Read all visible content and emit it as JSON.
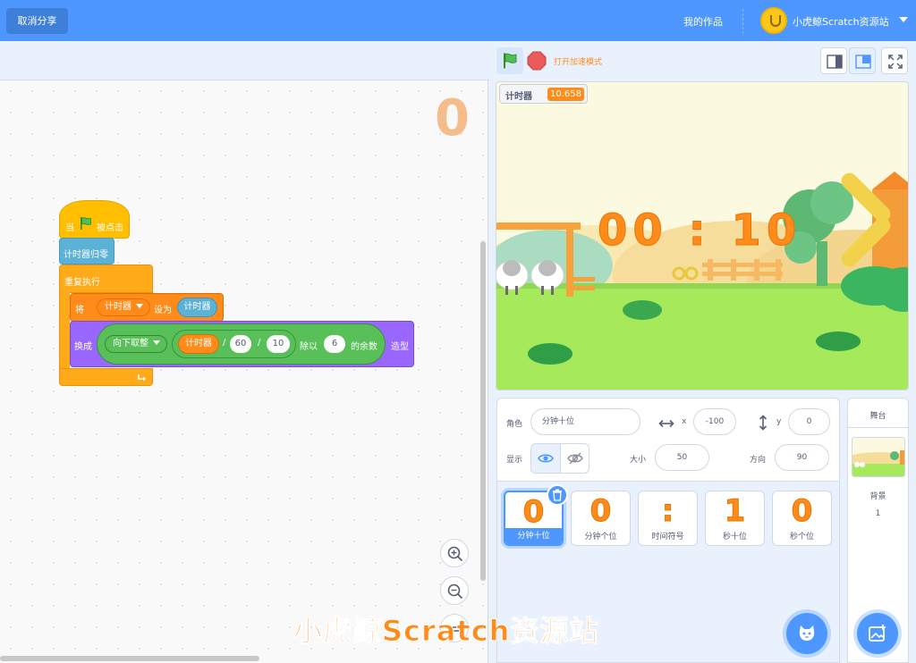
{
  "topbar": {
    "cancel_share": "取消分享",
    "my_works": "我的作品",
    "username": "小虎鲸Scratch资源站"
  },
  "code": {
    "watermark_costume": "0",
    "hat_when": "当",
    "hat_clicked": "被点击",
    "reset_timer": "计时器归零",
    "forever": "重复执行",
    "set_label": "将",
    "set_var": "计时器",
    "set_to": "设为",
    "set_value_reporter": "计时器",
    "switch_label": "换成",
    "round_mode": "向下取整",
    "timer_reporter": "计时器",
    "div_symbol_1": "/",
    "div_value_1": "60",
    "div_symbol_2": "/",
    "div_value_2": "10",
    "mod_label": "除以",
    "mod_value": "6",
    "mod_suffix": "的余数",
    "costume_suffix": "造型"
  },
  "stage_controls": {
    "turbo_label": "打开加速模式"
  },
  "stage": {
    "monitor_label": "计时器",
    "monitor_value": "10.658",
    "clock_text": "00 : 10"
  },
  "sprite_info": {
    "sprite_label": "角色",
    "sprite_name": "分钟十位",
    "x_label": "x",
    "x_value": "-100",
    "y_label": "y",
    "y_value": "0",
    "show_label": "显示",
    "size_label": "大小",
    "size_value": "50",
    "direction_label": "方向",
    "direction_value": "90"
  },
  "sprites": [
    {
      "glyph": "0",
      "name": "分钟十位",
      "selected": true
    },
    {
      "glyph": "0",
      "name": "分钟个位",
      "selected": false
    },
    {
      "glyph": ":",
      "name": "时间符号",
      "selected": false
    },
    {
      "glyph": "1",
      "name": "秒十位",
      "selected": false
    },
    {
      "glyph": "0",
      "name": "秒个位",
      "selected": false
    }
  ],
  "stage_panel": {
    "title": "舞台",
    "backdrop_label": "背景",
    "backdrop_count": "1"
  },
  "watermark": "小虎鲸Scratch资源站",
  "colors": {
    "brand_blue": "#4d97ff",
    "accent_orange": "#ff8c1a",
    "events_yellow": "#ffbf00",
    "control_orange": "#ffab19",
    "looks_purple": "#9966ff",
    "operators_green": "#59c059",
    "variables_blue": "#5cb1d6"
  }
}
